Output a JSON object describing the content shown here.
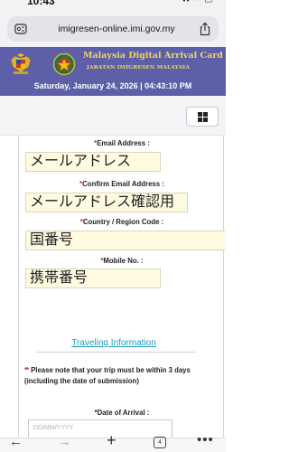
{
  "status_bar": {
    "time": "10:43",
    "indicators": "▪▪ ◠ ▭"
  },
  "browser": {
    "url": "imigresen-online.imi.gov.my",
    "site_icon": "page-settings-icon",
    "share_icon": "share-icon"
  },
  "banner": {
    "title": "Malaysia Digital Arrival Card",
    "subtitle": "JABATAN IMIGRESEN MALAYSIA",
    "datetime": "Saturday, January 24, 2026 | 04:43:10 PM",
    "background": "#5d5fa8",
    "title_color": "#f4d35e"
  },
  "menu": {
    "icon": "grid-menu-icon"
  },
  "form": {
    "required_mark": "*",
    "email": {
      "label": "Email Address :",
      "value": "メールアドレス"
    },
    "confirm_email": {
      "label": "Confirm Email Address :",
      "value": "メールアドレス確認用"
    },
    "country": {
      "label": "Country / Region Code :",
      "value": "国番号"
    },
    "mobile": {
      "label": "Mobile No. :",
      "value": "携帯番号"
    },
    "section_title": "Traveling Information",
    "note_marks": "**",
    "note": "Please note that your trip must be within 3 days (including the date of submission)",
    "arrival": {
      "label": "Date of Arrival :",
      "placeholder": "DD/MM/YYYY"
    },
    "accent_required": "#d62b2b",
    "link_color": "#1f9bb8",
    "field_bg": "#fffbe0"
  },
  "toolbar": {
    "back": "←",
    "forward": "→",
    "new_tab": "+",
    "tab_count": "4",
    "more": "•••"
  }
}
